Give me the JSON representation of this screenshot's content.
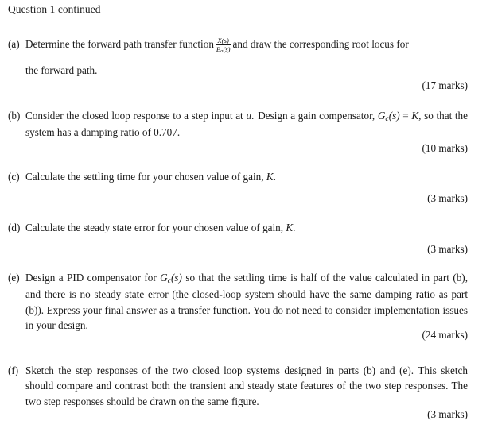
{
  "document": {
    "heading": "Question 1 continued",
    "parts": [
      {
        "label": "(a)",
        "text_before_fraction": "Determine the forward path transfer function",
        "fraction": {
          "numerator": "X(s)",
          "denominator": "Ea(s)",
          "denominator_base": "E",
          "denominator_sub": "a",
          "denominator_tail": "(s)"
        },
        "text_after_fraction": "and draw the corresponding root locus for",
        "line2": "the forward path.",
        "marks": "(17 marks)"
      },
      {
        "label": "(b)",
        "segments": {
          "s1": "Consider the closed loop response to a step input at",
          "var_u": "u",
          "s2": ".",
          "s3": "Design a gain compensator,",
          "gc_base": "G",
          "gc_sub": "c",
          "gc_tail": "(s)",
          "s4": "=",
          "var_k": "K",
          "s5": ", so that the system has a damping ratio of 0.707."
        },
        "marks": "(10 marks)"
      },
      {
        "label": "(c)",
        "text": "Calculate the settling time for your chosen value of gain,",
        "var_k": "K",
        "text_tail": ".",
        "marks": "(3 marks)"
      },
      {
        "label": "(d)",
        "text": "Calculate the steady state error for your chosen value of gain,",
        "var_k": "K",
        "text_tail": ".",
        "marks": "(3 marks)"
      },
      {
        "label": "(e)",
        "segments": {
          "s1": "Design a PID compensator for",
          "gc_base": "G",
          "gc_sub": "c",
          "gc_tail": "(s)",
          "s2": "so that the settling time is half of the value calculated in part (b), and there is no steady state error (the closed-loop system should have the same damping ratio as part (b)). Express your final answer as a transfer function. You do not need to consider implementation issues in your design."
        },
        "marks": "(24 marks)"
      },
      {
        "label": "(f)",
        "text": "Sketch the step responses of the two closed loop systems designed in parts (b) and (e). This sketch should compare and contrast both the transient and steady state features of the two step responses. The two step responses should be drawn on the same figure.",
        "marks": "(3 marks)"
      }
    ]
  }
}
